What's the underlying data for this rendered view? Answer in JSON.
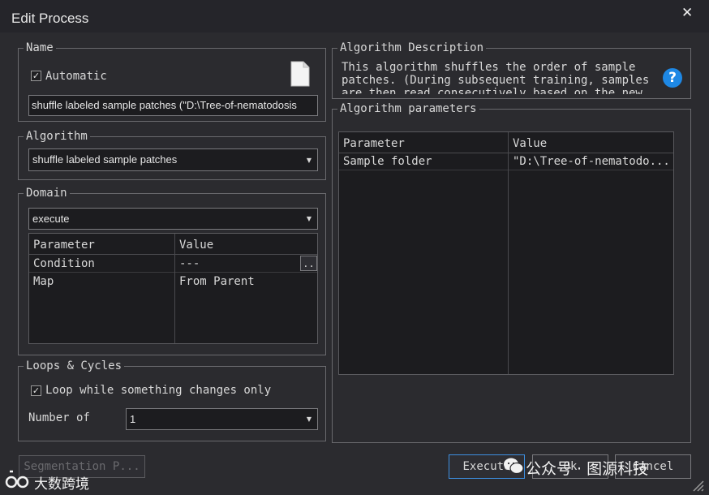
{
  "window": {
    "title": "Edit Process",
    "close_glyph": "✕"
  },
  "name_group": {
    "legend": "Name",
    "automatic_label": "Automatic",
    "automatic_checked": true,
    "value": "shuffle labeled sample patches (\"D:\\Tree-of-nematodosis"
  },
  "algorithm_group": {
    "legend": "Algorithm",
    "selected": "shuffle labeled sample patches"
  },
  "domain_group": {
    "legend": "Domain",
    "selected": "execute",
    "headers": [
      "Parameter",
      "Value"
    ],
    "rows": [
      {
        "param": "Condition",
        "value": "---",
        "ellipsis": ".."
      },
      {
        "param": "Map",
        "value": "From Parent"
      }
    ]
  },
  "loops_group": {
    "legend": "Loops & Cycles",
    "loop_label": "Loop while something changes only",
    "loop_checked": true,
    "number_label": "Number of",
    "number_value": "1"
  },
  "description_group": {
    "legend": "Algorithm Description",
    "text": "This algorithm shuffles the order of sample\npatches. (During subsequent training, samples\nare then read consecutively based on the new"
  },
  "params_group": {
    "legend": "Algorithm parameters",
    "headers": [
      "Parameter",
      "Value"
    ],
    "rows": [
      {
        "param": "Sample folder",
        "value": "\"D:\\Tree-of-nematodo..."
      }
    ]
  },
  "buttons": {
    "segmentation": "Segmentation P...",
    "execute": "Execute",
    "ok": "Ok",
    "cancel": "Cancel"
  },
  "watermark": {
    "left_brand": "大数跨境",
    "right_brand": "公众号 · 图源科技"
  },
  "check_glyph": "✓",
  "arrow_glyph": "▼"
}
